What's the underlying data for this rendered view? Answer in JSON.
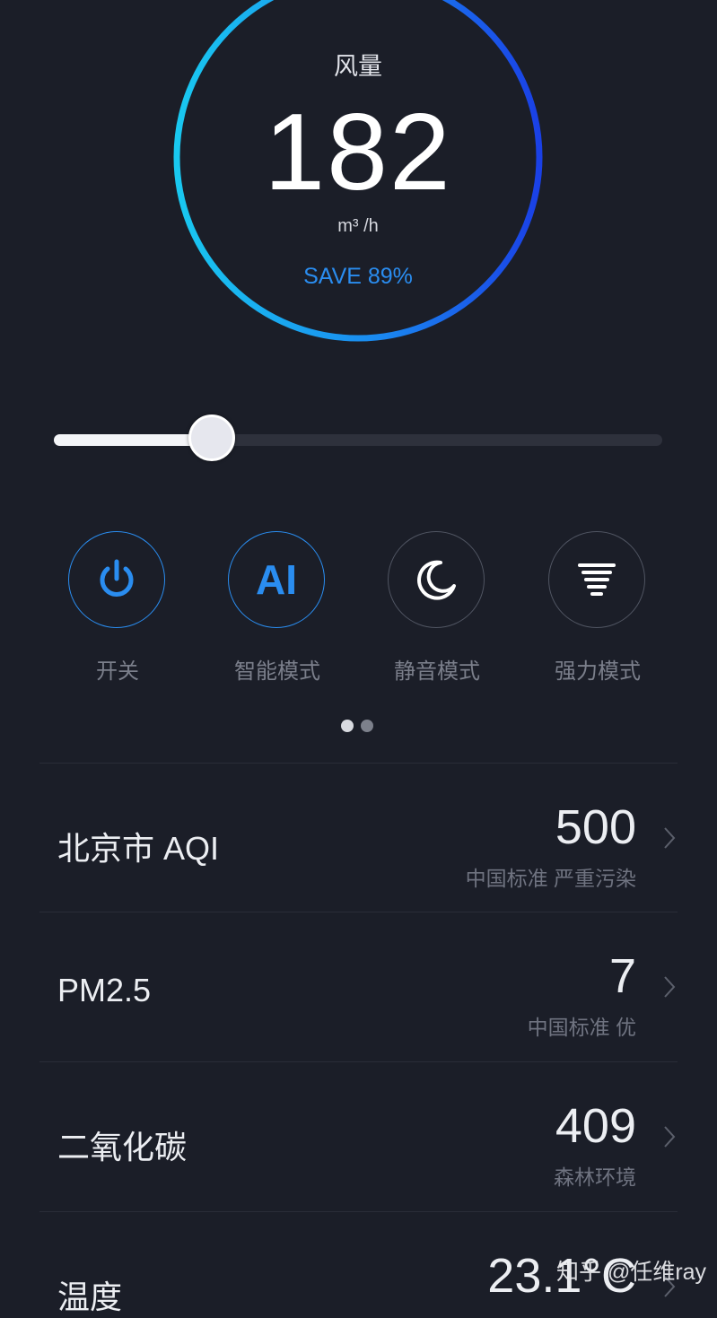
{
  "gauge": {
    "title": "风量",
    "value": "182",
    "unit": "m³ /h",
    "save": "SAVE 89%"
  },
  "slider": {
    "level": 0.26
  },
  "modes": [
    {
      "label": "开关",
      "icon": "power-icon",
      "active": true
    },
    {
      "label": "智能模式",
      "icon": "ai-icon",
      "icon_text": "AI",
      "active": true
    },
    {
      "label": "静音模式",
      "icon": "moon-icon",
      "active": false
    },
    {
      "label": "强力模式",
      "icon": "tornado-icon",
      "active": false
    }
  ],
  "pager": {
    "current": 1,
    "total": 2
  },
  "stats": [
    {
      "label": "北京市  AQI",
      "value": "500",
      "sub": "中国标准   严重污染"
    },
    {
      "label": "PM2.5",
      "value": "7",
      "sub": "中国标准   优"
    },
    {
      "label": "二氧化碳",
      "value": "409",
      "sub": "森林环境"
    },
    {
      "label": "温度",
      "value": "23.1°C",
      "sub": ""
    }
  ],
  "watermark": "知乎 @任维ray",
  "colors": {
    "background": "#1b1e28",
    "accent": "#2a8df0",
    "gauge_start": "#19c8f0",
    "gauge_end": "#1a47e6"
  }
}
